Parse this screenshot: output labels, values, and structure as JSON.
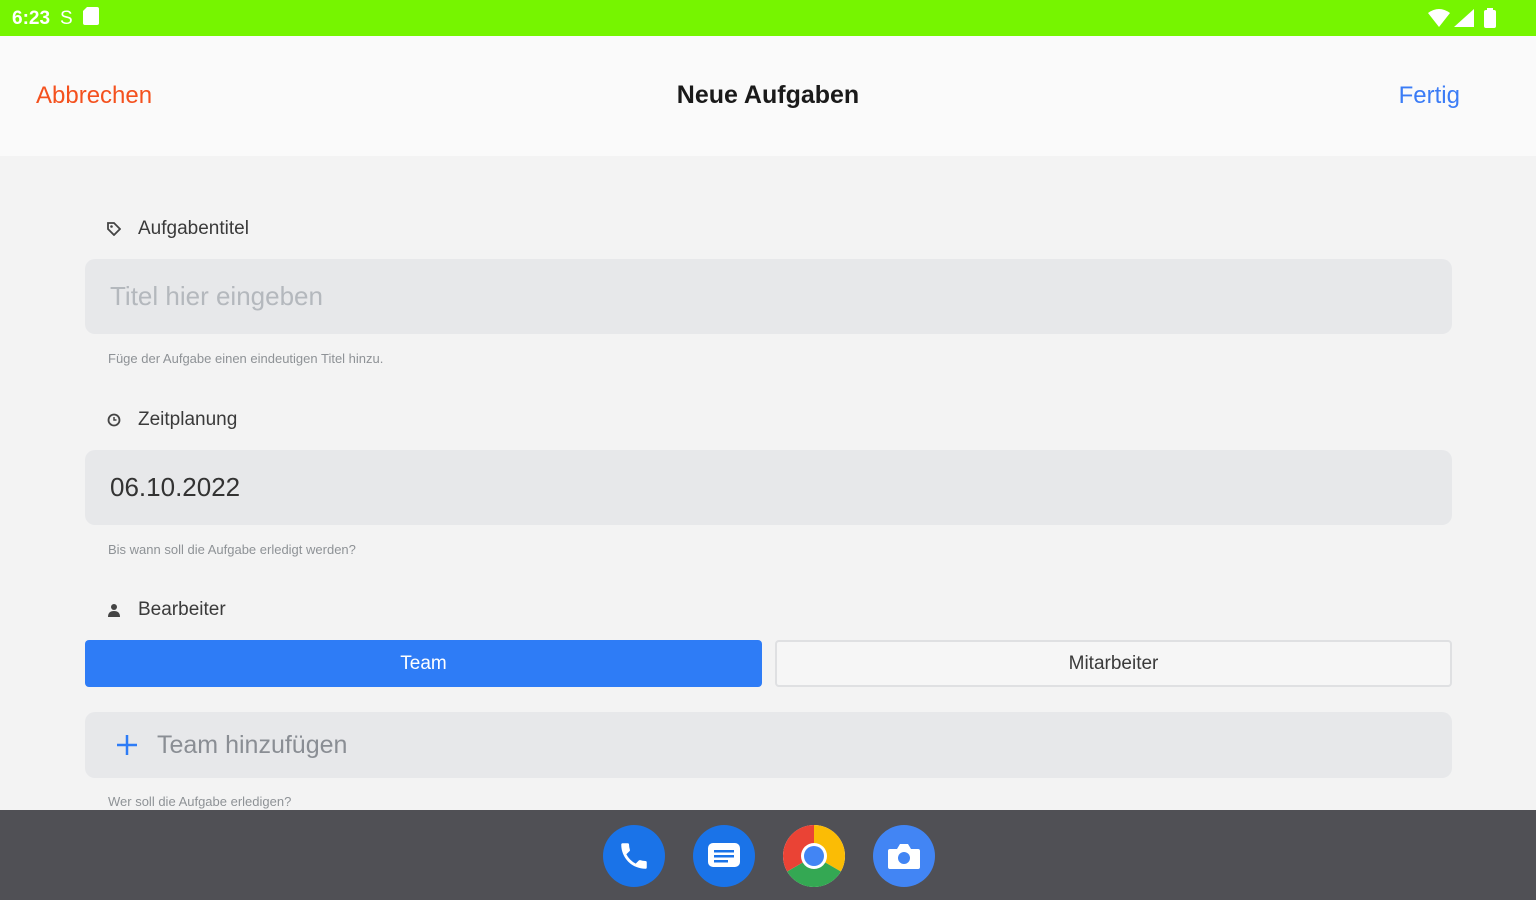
{
  "status_bar": {
    "time": "6:23",
    "carrier_icon": "S"
  },
  "header": {
    "cancel_label": "Abbrechen",
    "title": "Neue Aufgaben",
    "done_label": "Fertig"
  },
  "form": {
    "task_title": {
      "label": "Aufgabentitel",
      "placeholder": "Titel hier eingeben",
      "hint": "Füge der Aufgabe einen eindeutigen Titel hinzu."
    },
    "schedule": {
      "label": "Zeitplanung",
      "value": "06.10.2022",
      "hint": "Bis wann soll die Aufgabe erledigt werden?"
    },
    "assignee": {
      "label": "Bearbeiter",
      "options": [
        "Team",
        "Mitarbeiter"
      ],
      "selected": "Team",
      "add_label": "Team hinzufügen",
      "hint": "Wer soll die Aufgabe erledigen?"
    }
  },
  "colors": {
    "status_bar": "#76f500",
    "cancel": "#f4511e",
    "done": "#3b7cf6",
    "selected_segment": "#2e7cf6",
    "dock": "#505055"
  },
  "dock": {
    "apps": [
      "phone-icon",
      "messages-icon",
      "chrome-icon",
      "camera-icon"
    ]
  }
}
